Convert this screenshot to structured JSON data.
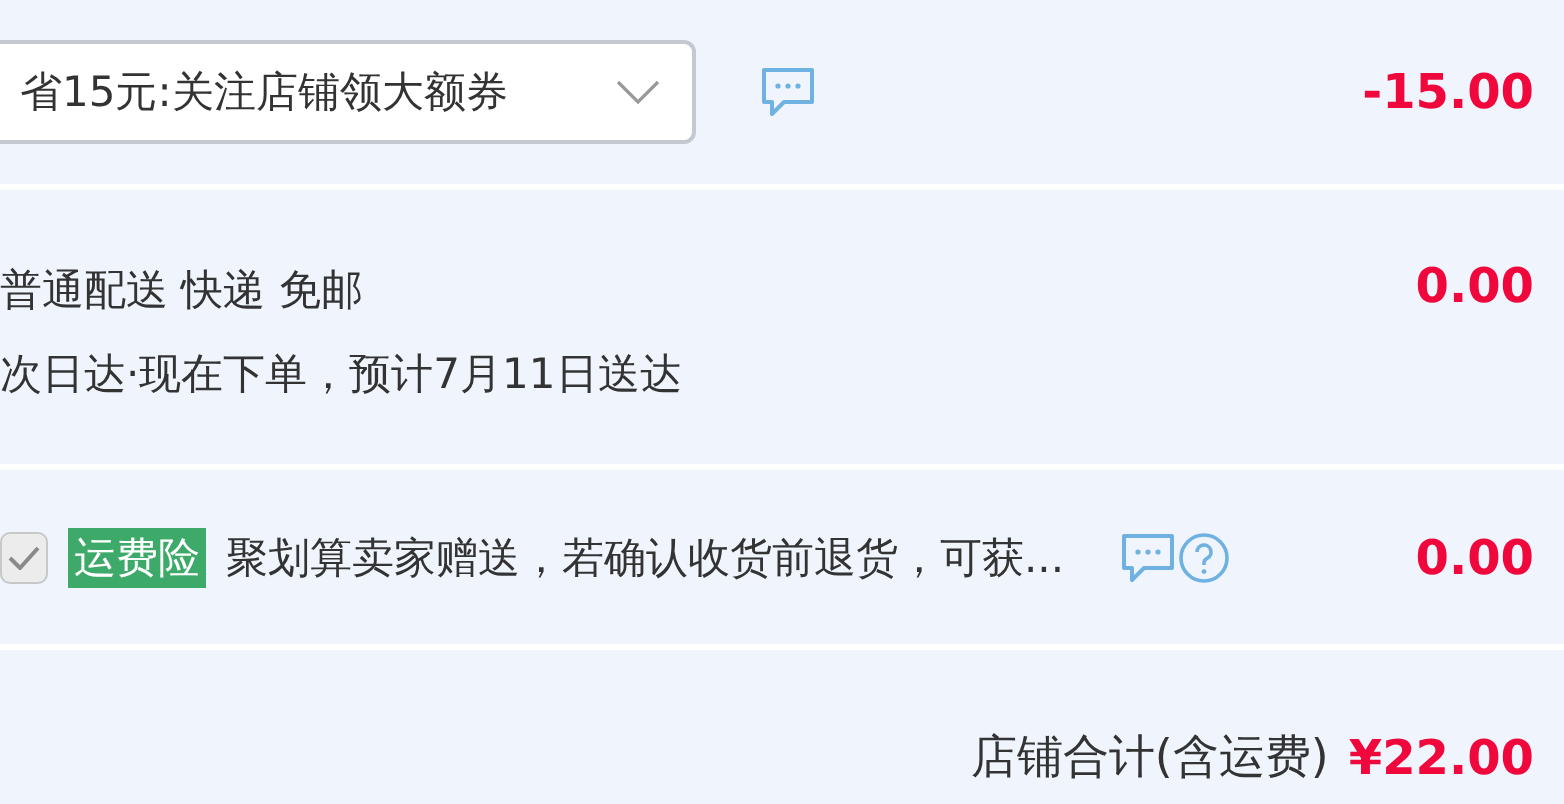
{
  "coupon": {
    "value": "省15元:关注店铺领大额券",
    "amount": "-15.00"
  },
  "delivery": {
    "lines": [
      "普通配送 快递 免邮",
      "次日达·现在下单，预计7月11日送达"
    ],
    "amount": "0.00"
  },
  "insurance": {
    "checked": true,
    "disabled": true,
    "tag": "运费险",
    "text": "聚划算卖家赠送，若确认收货前退货，可获...",
    "amount": "0.00"
  },
  "total": {
    "label": "店铺合计(含运费)",
    "amount": "¥22.00"
  }
}
